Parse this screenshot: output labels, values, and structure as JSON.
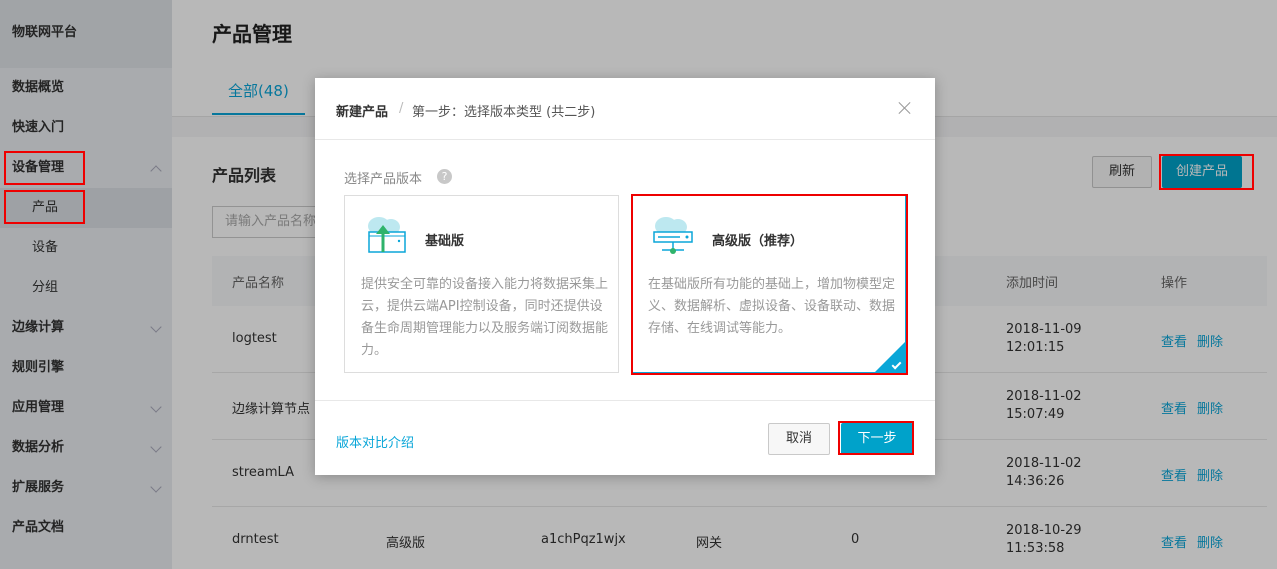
{
  "sidebar": {
    "brand": "物联网平台",
    "items": [
      {
        "label": "数据概览"
      },
      {
        "label": "快速入门"
      },
      {
        "label": "设备管理"
      },
      {
        "label": "产品"
      },
      {
        "label": "设备"
      },
      {
        "label": "分组"
      },
      {
        "label": "边缘计算"
      },
      {
        "label": "规则引擎"
      },
      {
        "label": "应用管理"
      },
      {
        "label": "数据分析"
      },
      {
        "label": "扩展服务"
      },
      {
        "label": "产品文档"
      }
    ]
  },
  "main": {
    "title": "产品管理",
    "tab_all": "全部(48)",
    "list_title": "产品列表",
    "refresh_label": "刷新",
    "create_label": "创建产品",
    "search_placeholder": "请输入产品名称",
    "headers": {
      "name": "产品名称",
      "added": "添加时间",
      "ops": "操作"
    },
    "rows": [
      {
        "name": "logtest",
        "version": "",
        "key": "",
        "type": "",
        "count": "",
        "date": "2018-11-09",
        "time": "12:01:15"
      },
      {
        "name": "边缘计算节点",
        "version": "",
        "key": "",
        "type": "",
        "count": "",
        "date": "2018-11-02",
        "time": "15:07:49"
      },
      {
        "name": "streamLA",
        "version": "",
        "key": "",
        "type": "",
        "count": "",
        "date": "2018-11-02",
        "time": "14:36:26"
      },
      {
        "name": "drntest",
        "version": "高级版",
        "key": "a1chPqz1wjx",
        "type": "网关",
        "count": "0",
        "date": "2018-10-29",
        "time": "11:53:58"
      }
    ],
    "op_view": "查看",
    "op_delete": "删除"
  },
  "modal": {
    "title": "新建产品",
    "separator": "/",
    "step": "第一步：选择版本类型 (共二步)",
    "choose_label": "选择产品版本",
    "help": "?",
    "basic": {
      "title": "基础版",
      "desc": "提供安全可靠的设备接入能力将数据采集上云，提供云端API控制设备，同时还提供设备生命周期管理能力以及服务端订阅数据能力。"
    },
    "advanced": {
      "title": "高级版（推荐）",
      "desc": "在基础版所有功能的基础上，增加物模型定义、数据解析、虚拟设备、设备联动、数据存储、在线调试等能力。",
      "selected": true
    },
    "compare_link": "版本对比介绍",
    "cancel_label": "取消",
    "next_label": "下一步"
  },
  "colors": {
    "accent": "#00a2ca",
    "highlight": "#e00000"
  }
}
